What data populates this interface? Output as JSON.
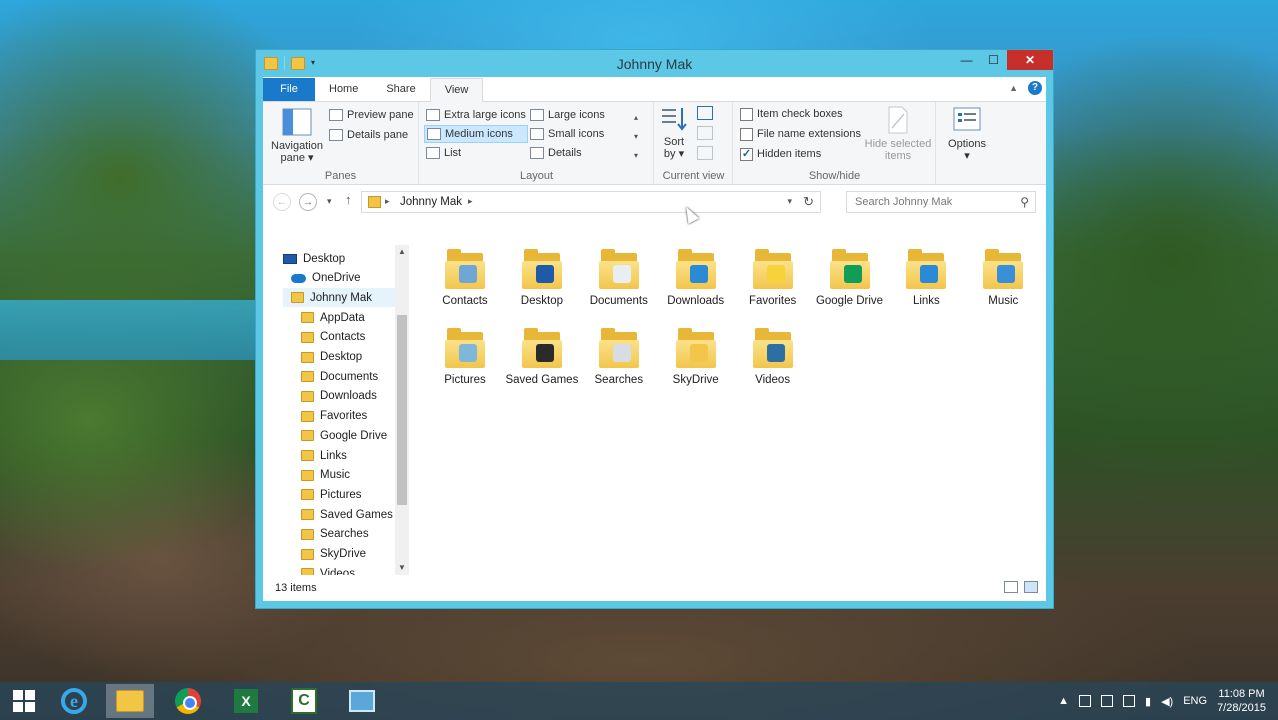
{
  "window": {
    "title": "Johnny Mak",
    "buttons": {
      "minimize": "—",
      "maximize": "☐",
      "close": "✕"
    }
  },
  "ribbon": {
    "tabs": [
      "File",
      "Home",
      "Share",
      "View"
    ],
    "active_tab": "View",
    "panes": {
      "label": "Panes",
      "navigation_pane": "Navigation",
      "navigation_pane_2": "pane ▾",
      "preview_pane": "Preview pane",
      "details_pane": "Details pane"
    },
    "layout": {
      "label": "Layout",
      "extra_large_icons": "Extra large icons",
      "large_icons": "Large icons",
      "medium_icons": "Medium icons",
      "small_icons": "Small icons",
      "list": "List",
      "details": "Details"
    },
    "current_view": {
      "label": "Current view",
      "sort_by": "Sort",
      "sort_by_2": "by ▾"
    },
    "show_hide": {
      "label": "Show/hide",
      "item_check_boxes": "Item check boxes",
      "file_name_extensions": "File name extensions",
      "hidden_items": "Hidden items",
      "hidden_items_checked": true,
      "hide_selected_items": "Hide selected",
      "hide_selected_items_2": "items"
    },
    "options": {
      "label": "Options",
      "arrow": "▾"
    }
  },
  "address": {
    "path": "Johnny Mak",
    "search_placeholder": "Search Johnny Mak"
  },
  "nav_tree": [
    {
      "label": "Desktop",
      "icon": "desktop-icon"
    },
    {
      "label": "OneDrive",
      "icon": "cloud-icon"
    },
    {
      "label": "Johnny Mak",
      "icon": "user-folder-icon",
      "selected": true
    },
    {
      "label": "AppData",
      "icon": "folder-icon"
    },
    {
      "label": "Contacts",
      "icon": "folder-icon"
    },
    {
      "label": "Desktop",
      "icon": "folder-icon"
    },
    {
      "label": "Documents",
      "icon": "folder-icon"
    },
    {
      "label": "Downloads",
      "icon": "folder-icon"
    },
    {
      "label": "Favorites",
      "icon": "folder-icon"
    },
    {
      "label": "Google Drive",
      "icon": "folder-icon"
    },
    {
      "label": "Links",
      "icon": "folder-icon"
    },
    {
      "label": "Music",
      "icon": "folder-icon"
    },
    {
      "label": "Pictures",
      "icon": "folder-icon"
    },
    {
      "label": "Saved Games",
      "icon": "folder-icon"
    },
    {
      "label": "Searches",
      "icon": "folder-icon"
    },
    {
      "label": "SkyDrive",
      "icon": "folder-icon"
    },
    {
      "label": "Videos",
      "icon": "folder-icon"
    }
  ],
  "files": [
    {
      "label": "Contacts",
      "emblem": "#6fa6d6"
    },
    {
      "label": "Desktop",
      "emblem": "#1e5aa8"
    },
    {
      "label": "Documents",
      "emblem": "#e9eef3"
    },
    {
      "label": "Downloads",
      "emblem": "#2a8ad6"
    },
    {
      "label": "Favorites",
      "emblem": "#f7d33b"
    },
    {
      "label": "Google Drive",
      "emblem": "#0f9d58"
    },
    {
      "label": "Links",
      "emblem": "#2a8ad6"
    },
    {
      "label": "Music",
      "emblem": "#3a8fd9"
    },
    {
      "label": "Pictures",
      "emblem": "#7fb7d9"
    },
    {
      "label": "Saved Games",
      "emblem": "#2b2b2b"
    },
    {
      "label": "Searches",
      "emblem": "#d7dde3"
    },
    {
      "label": "SkyDrive",
      "emblem": "#f2c64b"
    },
    {
      "label": "Videos",
      "emblem": "#2e6fa3"
    }
  ],
  "status": {
    "item_count": "13 items"
  },
  "taskbar": {
    "apps": [
      "start-icon",
      "internet-explorer-icon",
      "file-explorer-icon",
      "chrome-icon",
      "excel-icon",
      "camtasia-icon",
      "remote-desktop-icon"
    ],
    "active_app": "file-explorer-icon",
    "language": "ENG",
    "time": "11:08 PM",
    "date": "7/28/2015"
  }
}
